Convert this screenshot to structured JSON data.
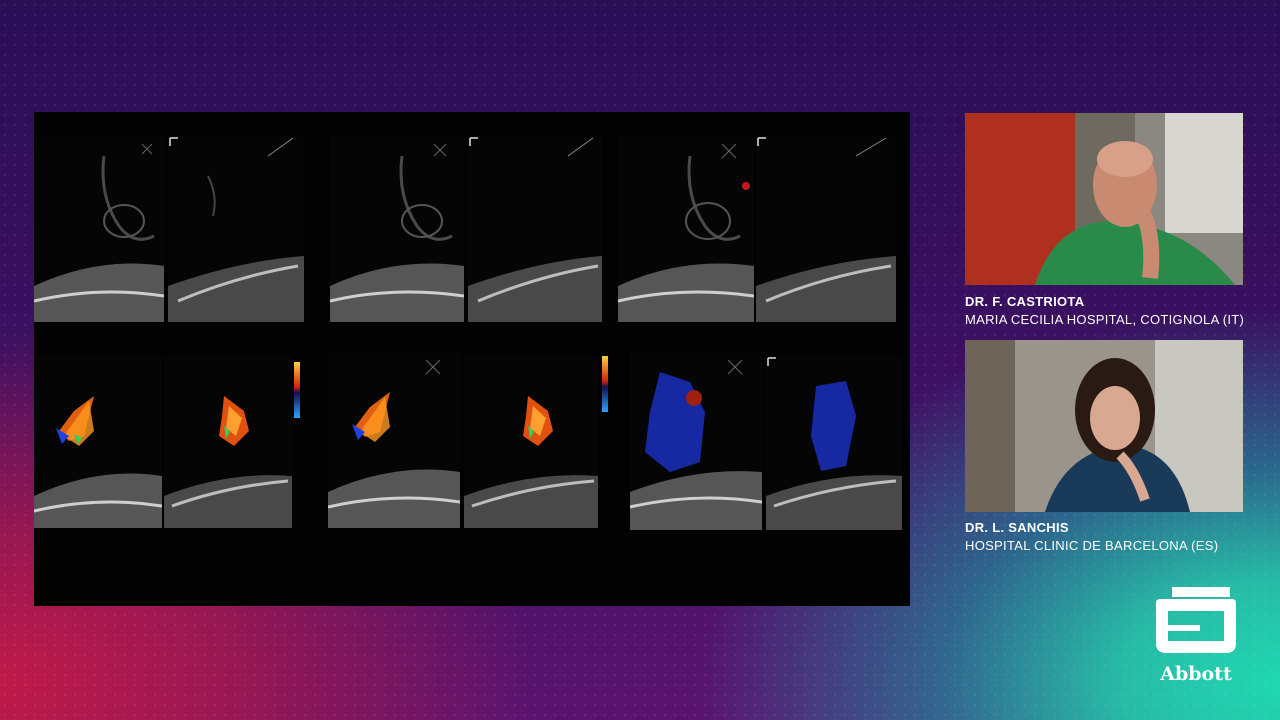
{
  "presenters": [
    {
      "name": "DR. F. CASTRIOTA",
      "affiliation": "MARIA CECILIA HOSPITAL, COTIGNOLA (IT)"
    },
    {
      "name": "DR. L. SANCHIS",
      "affiliation": "HOSPITAL CLINIC DE BARCELONA (ES)"
    }
  ],
  "brand": {
    "name": "Abbott",
    "color": "#ffffff"
  },
  "echo": {
    "rows": [
      "grayscale",
      "color-doppler"
    ],
    "frames_per_row": 6
  },
  "colors": {
    "background_top": "#2a0f55",
    "background_left": "#c01a4a",
    "background_right": "#1fd8b0",
    "echo_panel": "#020202"
  }
}
